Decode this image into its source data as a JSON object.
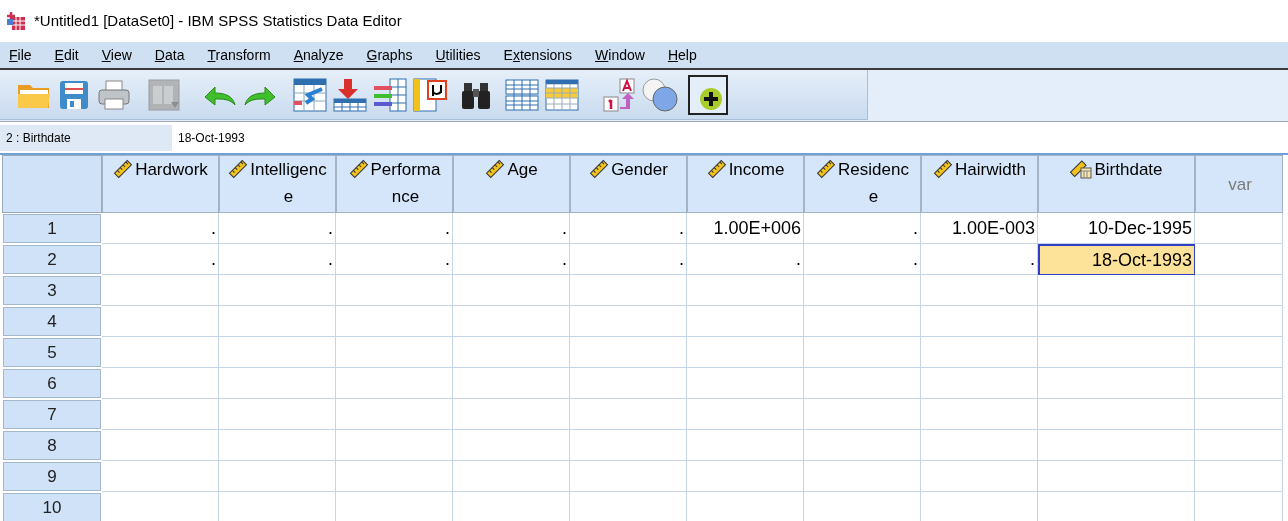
{
  "window": {
    "title": "*Untitled1 [DataSet0] - IBM SPSS Statistics Data Editor"
  },
  "menu": [
    {
      "key": "F",
      "after": "ile"
    },
    {
      "key": "E",
      "after": "dit"
    },
    {
      "key": "V",
      "after": "iew"
    },
    {
      "key": "D",
      "after": "ata"
    },
    {
      "key": "T",
      "after": "ransform"
    },
    {
      "key": "A",
      "after": "nalyze"
    },
    {
      "key": "G",
      "after": "raphs"
    },
    {
      "key": "U",
      "after": "tilities"
    },
    {
      "before": "E",
      "key": "x",
      "after": "tensions"
    },
    {
      "key": "W",
      "after": "indow"
    },
    {
      "key": "H",
      "after": "elp"
    }
  ],
  "cell_editor": {
    "reference": "2 : Birthdate",
    "value": "18-Oct-1993"
  },
  "table": {
    "columns": [
      {
        "lines": [
          "Hardwork"
        ],
        "kind": "scale"
      },
      {
        "lines": [
          "Intelligenc",
          "e"
        ],
        "kind": "scale"
      },
      {
        "lines": [
          "Performa",
          "nce"
        ],
        "kind": "scale"
      },
      {
        "lines": [
          "Age"
        ],
        "kind": "scale"
      },
      {
        "lines": [
          "Gender"
        ],
        "kind": "scale"
      },
      {
        "lines": [
          "Income"
        ],
        "kind": "scale"
      },
      {
        "lines": [
          "Residenc",
          "e"
        ],
        "kind": "scale"
      },
      {
        "lines": [
          "Hairwidth"
        ],
        "kind": "scale"
      },
      {
        "lines": [
          "Birthdate"
        ],
        "kind": "date"
      },
      {
        "lines": [
          "var"
        ],
        "kind": "empty"
      }
    ],
    "rows": [
      {
        "number": "1",
        "cells": [
          {
            "value": ".",
            "selected": false
          },
          {
            "value": ".",
            "selected": false
          },
          {
            "value": ".",
            "selected": false
          },
          {
            "value": ".",
            "selected": false
          },
          {
            "value": ".",
            "selected": false
          },
          {
            "value": "1.00E+006",
            "selected": false
          },
          {
            "value": ".",
            "selected": false
          },
          {
            "value": "1.00E-003",
            "selected": false
          },
          {
            "value": "10-Dec-1995",
            "selected": false
          },
          {
            "selected": false
          }
        ]
      },
      {
        "number": "2",
        "cells": [
          {
            "value": ".",
            "selected": false
          },
          {
            "value": ".",
            "selected": false
          },
          {
            "value": ".",
            "selected": false
          },
          {
            "value": ".",
            "selected": false
          },
          {
            "value": ".",
            "selected": false
          },
          {
            "value": ".",
            "selected": false
          },
          {
            "value": ".",
            "selected": false
          },
          {
            "value": ".",
            "selected": false
          },
          {
            "value": "18-Oct-1993",
            "selected": true
          },
          {
            "selected": false
          }
        ]
      },
      {
        "number": "3",
        "cells": []
      },
      {
        "number": "4",
        "cells": []
      },
      {
        "number": "5",
        "cells": []
      },
      {
        "number": "6",
        "cells": []
      },
      {
        "number": "7",
        "cells": []
      },
      {
        "number": "8",
        "cells": []
      },
      {
        "number": "9",
        "cells": []
      },
      {
        "number": "10",
        "cells": []
      }
    ]
  }
}
